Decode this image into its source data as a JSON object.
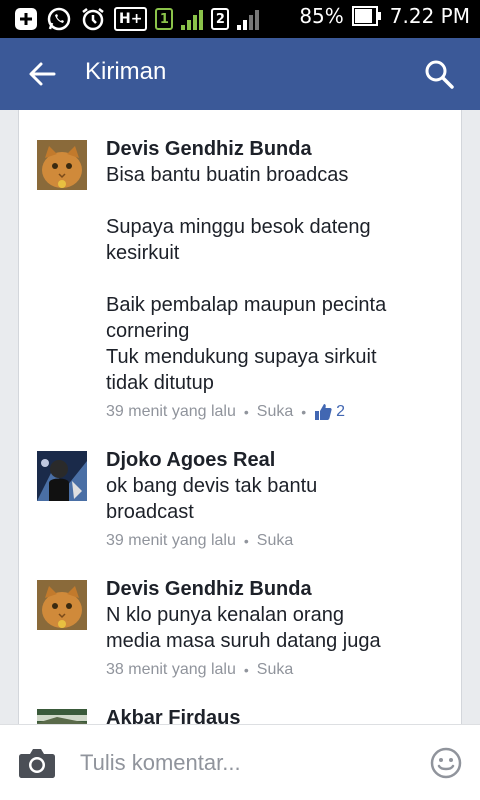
{
  "status_bar": {
    "network_type": "H+",
    "sim1": "1",
    "sim2": "2",
    "battery_percent": "85%",
    "time": "7.22 PM",
    "icons": [
      "plus-notification-icon",
      "whatsapp-icon",
      "alarm-icon",
      "network-h-plus-icon",
      "sim1-signal-icon",
      "sim2-signal-icon",
      "battery-icon"
    ]
  },
  "app_bar": {
    "title": "Kiriman",
    "back_icon": "arrow-left",
    "search_icon": "magnifier"
  },
  "comments": [
    {
      "author": "Devis Gendhiz Bunda",
      "avatar": "orange-cat",
      "lines": [
        "Bisa bantu buatin broadcas",
        "",
        "Supaya minggu besok dateng",
        "kesirkuit",
        "",
        "Baik pembalap maupun pecinta",
        "cornering",
        "Tuk mendukung supaya sirkuit",
        "tidak ditutup"
      ],
      "time": "39 menit yang lalu",
      "like_label": "Suka",
      "like_count": "2"
    },
    {
      "author": "Djoko Agoes Real",
      "avatar": "rider-photo",
      "lines": [
        "ok bang devis tak bantu",
        "broadcast"
      ],
      "time": "39 menit yang lalu",
      "like_label": "Suka"
    },
    {
      "author": "Devis Gendhiz Bunda",
      "avatar": "orange-cat",
      "lines": [
        "N klo punya kenalan orang",
        "media masa suruh datang juga"
      ],
      "time": "38 menit yang lalu",
      "like_label": "Suka"
    },
    {
      "author": "Akbar Firdaus",
      "avatar": "photo"
    }
  ],
  "composer": {
    "placeholder": "Tulis komentar...",
    "camera_icon": "camera",
    "emoji_icon": "smiley"
  },
  "colors": {
    "brand": "#3b5998",
    "link": "#4267b2",
    "meta": "#90949c",
    "background": "#e9ebee"
  }
}
